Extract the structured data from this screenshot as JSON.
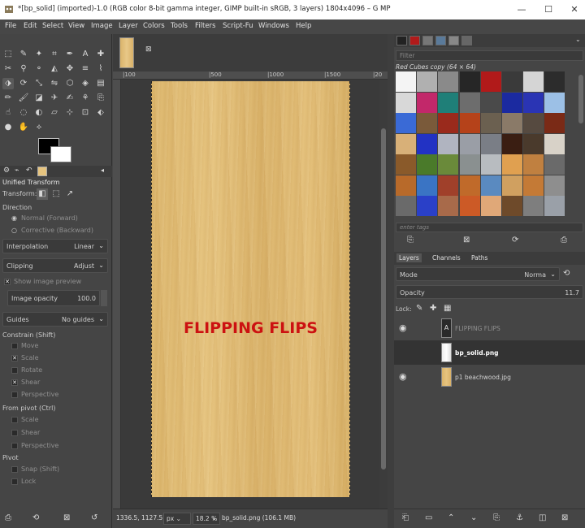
{
  "titlebar": {
    "title": "*[bp_solid] (imported)-1.0 (RGB color 8-bit gamma integer, GIMP built-in sRGB, 3 layers) 1804x4096 – G MP",
    "minimize": "—",
    "maximize": "☐",
    "close": "✕"
  },
  "menubar": [
    "File",
    "Edit",
    "Select",
    "View",
    "Image",
    "Layer",
    "Colors",
    "Tools",
    "Filters",
    "Script-Fu",
    "Windows",
    "Help"
  ],
  "tool_options": {
    "title": "Unified Transform",
    "transform_label": "Transform:",
    "direction_label": "Direction",
    "direction_normal": "Normal (Forward)",
    "direction_corrective": "Corrective (Backward)",
    "interpolation_label": "Interpolation",
    "interpolation_value": "Linear",
    "clipping_label": "Clipping",
    "clipping_value": "Adjust",
    "show_preview": "Show image preview",
    "opacity_label": "Image opacity",
    "opacity_value": "100.0",
    "guides_label": "Guides",
    "guides_value": "No guides",
    "constrain_label": "Constrain (Shift)",
    "constrain_items": [
      {
        "label": "Move",
        "checked": false
      },
      {
        "label": "Scale",
        "checked": true
      },
      {
        "label": "Rotate",
        "checked": false
      },
      {
        "label": "Shear",
        "checked": true
      },
      {
        "label": "Perspective",
        "checked": false
      }
    ],
    "from_pivot_label": "From pivot  (Ctrl)",
    "from_pivot_items": [
      {
        "label": "Scale",
        "checked": false
      },
      {
        "label": "Shear",
        "checked": false
      },
      {
        "label": "Perspective",
        "checked": false
      }
    ],
    "pivot_label": "Pivot",
    "pivot_items": [
      {
        "label": "Snap (Shift)",
        "checked": false
      },
      {
        "label": "Lock",
        "checked": false
      }
    ]
  },
  "canvas": {
    "ruler_marks": [
      "|100",
      "|500",
      "|1000",
      "|1500",
      "|20"
    ],
    "overlay_text": "FLIPPING FLIPS",
    "coords": "1336.5, 1127.5",
    "unit": "px",
    "zoom": "18.2 %",
    "status": "bp_solid.png (106.1 MB)"
  },
  "patterns": {
    "filter_placeholder": "Filter",
    "selected_name": "Red Cubes copy (64 × 64)",
    "tags_placeholder": "enter tags",
    "colors": [
      "#f4f4f4",
      "#b0b0b0",
      "#8a8a8a",
      "#262626",
      "#b11a1a",
      "#3a3a3a",
      "#d5d5d5",
      "#2c2c2c",
      "#d8d8d8",
      "#c2286a",
      "#1f7f78",
      "#6d6d6d",
      "#4a4a4a",
      "#1b2aa0",
      "#2a34b4",
      "#9cc0e6",
      "#3a6ad6",
      "#7a5a3a",
      "#9a2a1c",
      "#b5421a",
      "#6b6050",
      "#8a7a68",
      "#564a40",
      "#7a2a16",
      "#d8b078",
      "#2232c4",
      "#b0b4c0",
      "#9a9ea6",
      "#7a7e86",
      "#3a1e12",
      "#4a3a2c",
      "#d8d2c8",
      "#8a5a2a",
      "#4a7a2a",
      "#6a8a3a",
      "#8a9090",
      "#b8bcc0",
      "#e0a050",
      "#c08040",
      "#6a6a6a",
      "#b86a2a",
      "#3a74c4",
      "#a0402a",
      "#c06a2a",
      "#5a8ac0",
      "#d0a060",
      "#c47a36",
      "#8e8e8e",
      "#6a6a6a",
      "#2a40c8",
      "#a86a4a",
      "#cc5a26",
      "#e0a878",
      "#6e4a2a",
      "#7e7e7e",
      "#9aa0a8"
    ]
  },
  "layers": {
    "tabs": [
      "Layers",
      "Channels",
      "Paths"
    ],
    "mode_label": "Mode",
    "mode_value": "Norma",
    "opacity_label": "Opacity",
    "opacity_value": "11.7",
    "lock_label": "Lock:",
    "items": [
      {
        "name": "FLIPPING FLIPS",
        "visible": true,
        "thumb": "text"
      },
      {
        "name": "bp_solid.png",
        "visible": false,
        "thumb": "white"
      },
      {
        "name": "p1 beachwood.jpg",
        "visible": true,
        "thumb": "wood"
      }
    ]
  }
}
